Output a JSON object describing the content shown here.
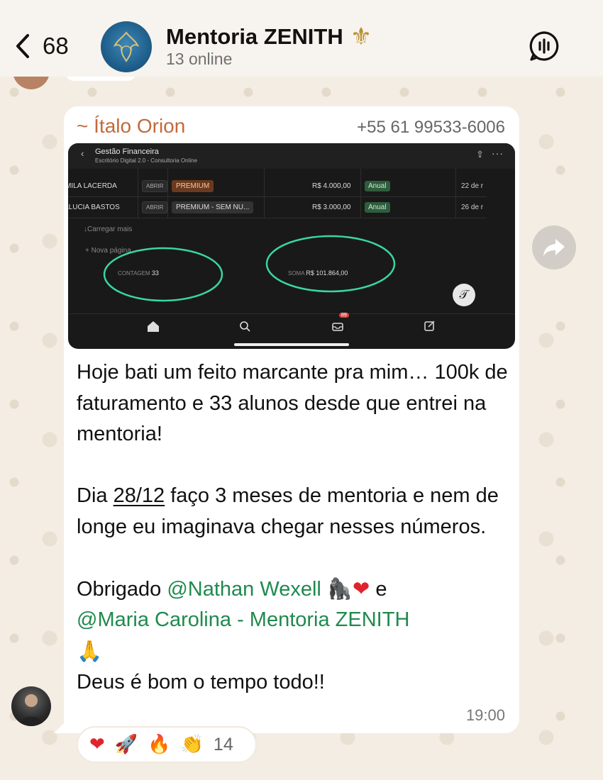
{
  "header": {
    "back_count": "68",
    "title": "Mentoria ZENITH",
    "title_emoji": "⚜",
    "subtitle": "13 online"
  },
  "message": {
    "sender_name": "~ Ítalo Orion",
    "sender_phone": "+55 61 99533-6006",
    "time": "19:00",
    "text": {
      "p1": "Hoje bati um feito marcante pra mim… 100k de faturamento e 33 alunos desde que entrei na mentoria!",
      "p2_before": "Dia ",
      "p2_date": "28/12",
      "p2_after": " faço 3 meses de mentoria e nem de longe eu imaginava chegar nesses números.",
      "p3_before": "Obrigado ",
      "mention1": "@Nathan Wexell",
      "p3_emojis1": "🦍",
      "p3_heart": "❤",
      "p3_mid": " e",
      "mention2": "@Maria Carolina - Mentoria ZENITH",
      "p3_emoji2": "🙏",
      "p4": "Deus é bom o tempo todo!!"
    }
  },
  "screenshot": {
    "title": "Gestão Financeira",
    "subtitle": "Escritório Digital 2.0 - Consultoria Online",
    "rows": [
      {
        "name": "MILA LACERDA",
        "open": "ABRIR",
        "plan": "PREMIUM",
        "amount": "R$ 4.000,00",
        "cycle": "Anual",
        "date": "22 de r"
      },
      {
        "name": "ALUCIA BASTOS",
        "open": "ABRIR",
        "plan": "PREMIUM - SEM NU...",
        "amount": "R$ 3.000,00",
        "cycle": "Anual",
        "date": "26 de r"
      }
    ],
    "load_more": "Carregar mais",
    "new_page": "Nova página",
    "count_label": "CONTAGEM",
    "count_value": "33",
    "sum_label": "SOMA",
    "sum_value": "R$ 101.864,00",
    "inbox_badge": "89",
    "highlight_color": "#3ad6a0"
  },
  "reactions": {
    "emojis": [
      "❤",
      "🚀",
      "🔥",
      "👏"
    ],
    "count": "14"
  },
  "colors": {
    "sender_name": "#c26a3b",
    "mention": "#1f8a4e",
    "wallpaper": "#f3ede3"
  }
}
